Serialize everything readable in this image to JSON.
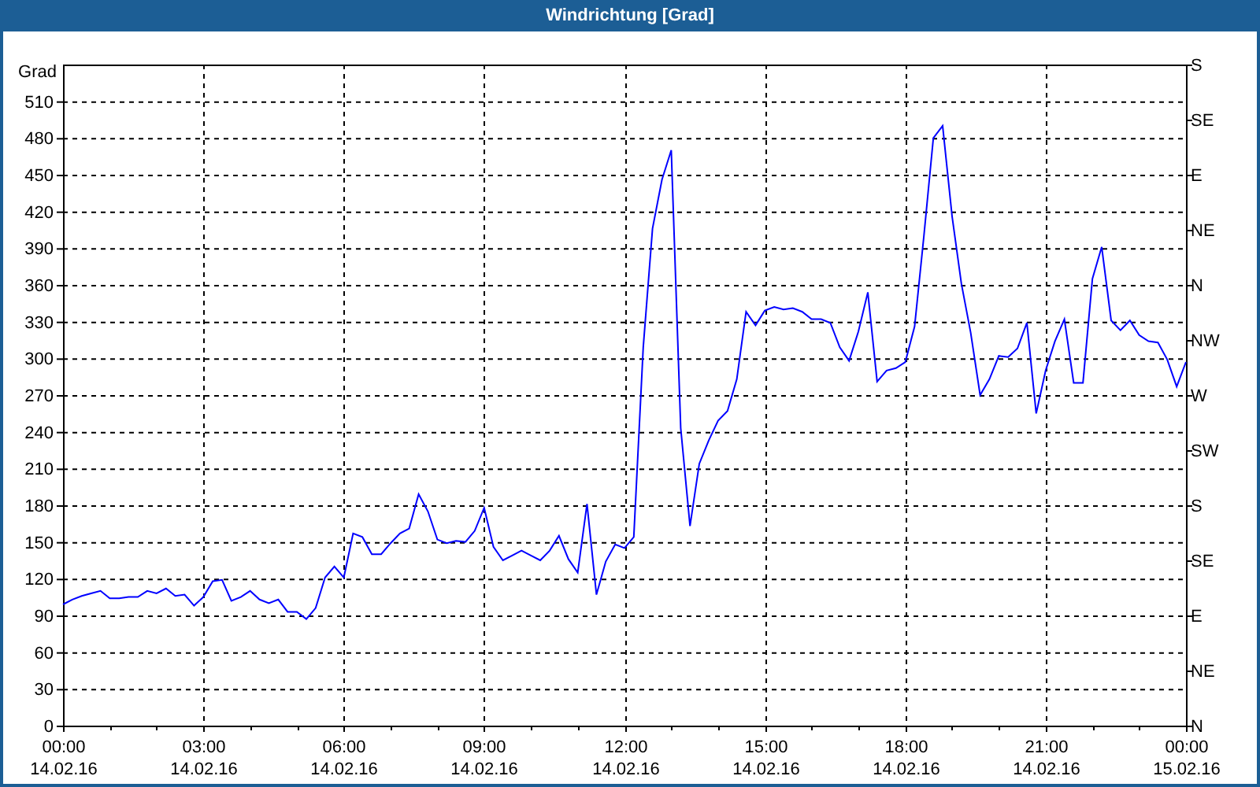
{
  "compass_labels": [
    "S",
    "SE",
    "E",
    "NE",
    "N",
    "NW",
    "W",
    "SW",
    "S",
    "SE",
    "E",
    "NE",
    "N"
  ],
  "chart_data": {
    "type": "line",
    "title": "Windrichtung [Grad]",
    "ylabel": "Grad",
    "ylim": [
      0,
      540
    ],
    "grid": true,
    "yticks": [
      0,
      30,
      60,
      90,
      120,
      150,
      180,
      210,
      240,
      270,
      300,
      330,
      360,
      390,
      420,
      450,
      480,
      510
    ],
    "categories": [
      "00:00\n14.02.16",
      null,
      null,
      null,
      null,
      null,
      null,
      null,
      null,
      null,
      null,
      null,
      null,
      null,
      null,
      "03:00\n14.02.16",
      null,
      null,
      null,
      null,
      null,
      null,
      null,
      null,
      null,
      null,
      null,
      null,
      null,
      null,
      "06:00\n14.02.16",
      null,
      null,
      null,
      null,
      null,
      null,
      null,
      null,
      null,
      null,
      null,
      null,
      null,
      null,
      "09:00\n14.02.16",
      null,
      null,
      null,
      null,
      null,
      null,
      null,
      null,
      null,
      null,
      null,
      null,
      null,
      null,
      "12:00\n14.02.16",
      null,
      null,
      null,
      null,
      null,
      null,
      null,
      null,
      null,
      null,
      null,
      null,
      null,
      null,
      "15:00\n14.02.16",
      null,
      null,
      null,
      null,
      null,
      null,
      null,
      null,
      null,
      null,
      null,
      null,
      null,
      null,
      "18:00\n14.02.16",
      null,
      null,
      null,
      null,
      null,
      null,
      null,
      null,
      null,
      null,
      null,
      null,
      null,
      null,
      "21:00\n14.02.16",
      null,
      null,
      null,
      null,
      null,
      null,
      null,
      null,
      null,
      null,
      null,
      null,
      null,
      null,
      "00:00\n15.02.16"
    ],
    "series": [
      {
        "color": "#0000ff",
        "values": [
          99,
          103,
          106,
          108,
          110,
          104,
          104,
          105,
          105,
          110,
          108,
          112,
          106,
          107,
          98,
          105,
          118,
          119,
          102,
          105,
          110,
          103,
          100,
          103,
          93,
          93,
          87,
          96,
          121,
          130,
          121,
          157,
          154,
          140,
          140,
          149,
          157,
          161,
          189,
          175,
          152,
          149,
          151,
          150,
          159,
          178,
          146,
          135,
          139,
          143,
          139,
          135,
          143,
          155,
          136,
          125,
          181,
          107,
          134,
          148,
          145,
          154,
          309,
          406,
          446,
          470,
          243,
          163,
          214,
          233,
          249,
          257,
          283,
          338,
          327,
          339,
          342,
          340,
          341,
          338,
          332,
          332,
          329,
          309,
          298,
          322,
          354,
          281,
          290,
          292,
          297,
          326,
          400,
          480,
          490,
          416,
          361,
          321,
          270,
          283,
          302,
          301,
          308,
          329,
          255,
          290,
          314,
          332,
          280,
          280,
          365,
          391,
          331,
          323,
          331,
          319,
          314,
          313,
          299,
          277,
          297
        ]
      }
    ]
  }
}
